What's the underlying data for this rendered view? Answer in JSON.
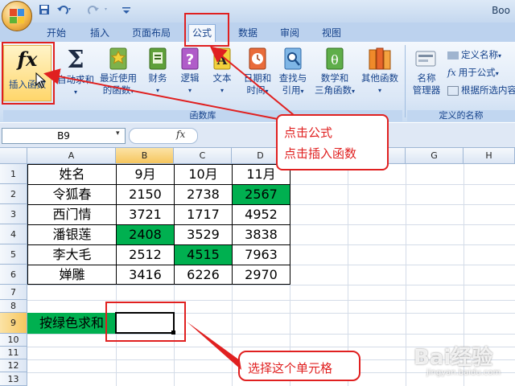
{
  "app": {
    "title_fragment": "Boo"
  },
  "tabs": [
    "开始",
    "插入",
    "页面布局",
    "公式",
    "数据",
    "审阅",
    "视图"
  ],
  "ribbon": {
    "insert_function_line1": "插入函数",
    "autosum": "自动求和",
    "recent_line1": "最近使用",
    "recent_line2": "的函数",
    "financial": "财务",
    "logical": "逻辑",
    "text": "文本",
    "datetime_line1": "日期和",
    "datetime_line2": "时间",
    "lookup_line1": "查找与",
    "lookup_line2": "引用",
    "math_line1": "数学和",
    "math_line2": "三角函数",
    "other": "其他函数",
    "name_mgr_line1": "名称",
    "name_mgr_line2": "管理器",
    "define_name": "定义名称",
    "use_in_formula": "用于公式",
    "create_from_sel": "根据所选内容创建",
    "group_library": "函数库",
    "group_names": "定义的名称",
    "fx_symbol": "fx",
    "sigma": "Σ",
    "dropdown_glyph": "▾"
  },
  "formula_bar": {
    "name_box": "B9",
    "fx": "fx"
  },
  "columns": [
    "A",
    "B",
    "C",
    "D",
    "E",
    "F",
    "G",
    "H"
  ],
  "rows": [
    "1",
    "2",
    "3",
    "4",
    "5",
    "6",
    "7",
    "8",
    "9",
    "10",
    "11",
    "12",
    "13"
  ],
  "table": {
    "header": [
      "姓名",
      "9月",
      "10月",
      "11月"
    ],
    "data": [
      [
        "令狐春",
        "2150",
        "2738",
        "2567"
      ],
      [
        "西门情",
        "3721",
        "1717",
        "4952"
      ],
      [
        "潘银莲",
        "2408",
        "3529",
        "3838"
      ],
      [
        "李大毛",
        "2512",
        "4515",
        "7963"
      ],
      [
        "婵雕",
        "3416",
        "6226",
        "2970"
      ]
    ],
    "green_cells": [
      "D2",
      "B4",
      "C5"
    ],
    "green_color": "#00b050"
  },
  "label_a9": "按绿色求和",
  "annotations": {
    "callout1_line1": "点击公式",
    "callout1_line2": "点击插入函数",
    "callout2": "选择这个单元格",
    "color": "#e02020"
  },
  "watermark": {
    "main": "Bai经验",
    "sub": "jingyan.baidu.com"
  }
}
